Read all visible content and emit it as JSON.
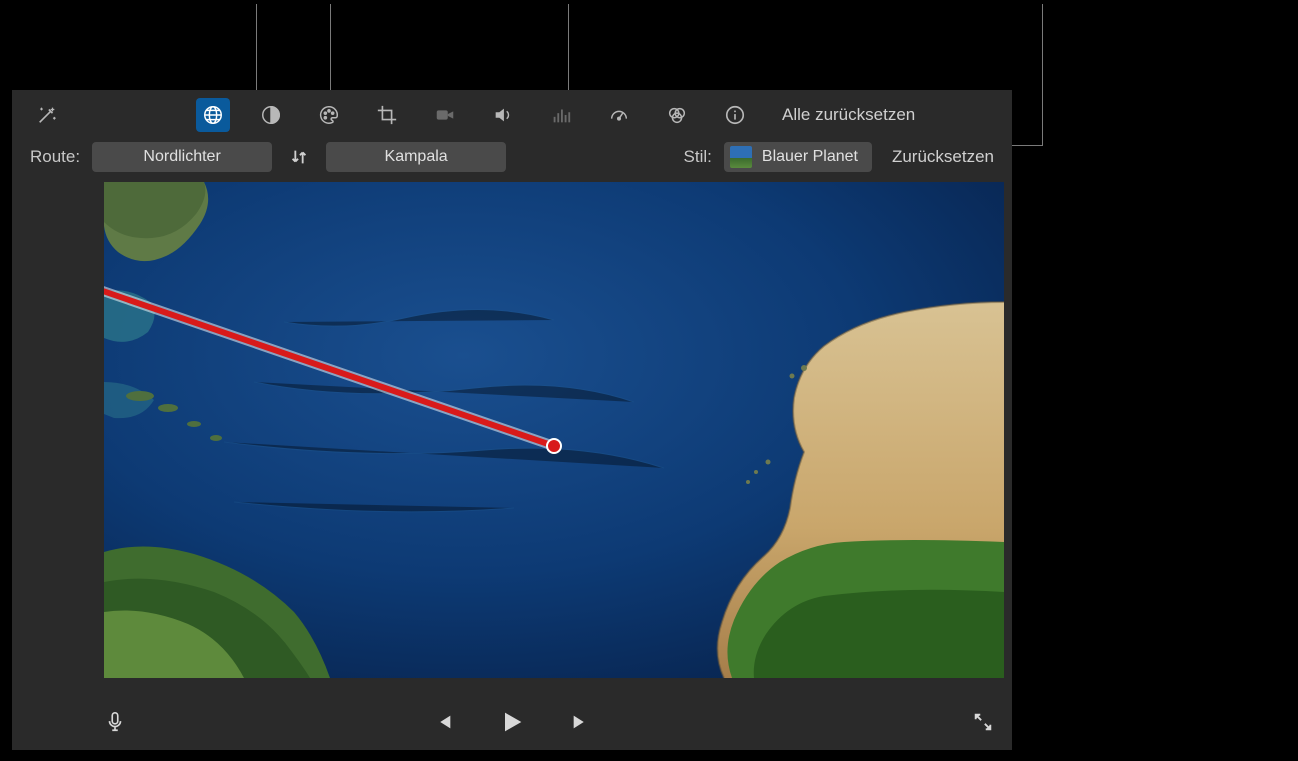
{
  "toolbar": {
    "reset_all": "Alle zurücksetzen"
  },
  "route": {
    "label": "Route:",
    "start": "Nordlichter",
    "end": "Kampala"
  },
  "style": {
    "label": "Stil:",
    "value": "Blauer Planet",
    "reset": "Zurücksetzen"
  },
  "icons": {
    "wand": "magic-wand-icon",
    "globe": "globe-icon",
    "contrast": "contrast-icon",
    "palette": "palette-icon",
    "crop": "crop-icon",
    "camera": "camera-icon",
    "volume": "volume-icon",
    "eq": "equalizer-icon",
    "speed": "speed-icon",
    "filters": "filters-icon",
    "info": "info-icon",
    "swap": "swap-icon",
    "mic": "microphone-icon",
    "prev": "previous-icon",
    "play": "play-icon",
    "next": "next-icon",
    "fullscreen": "fullscreen-icon"
  }
}
